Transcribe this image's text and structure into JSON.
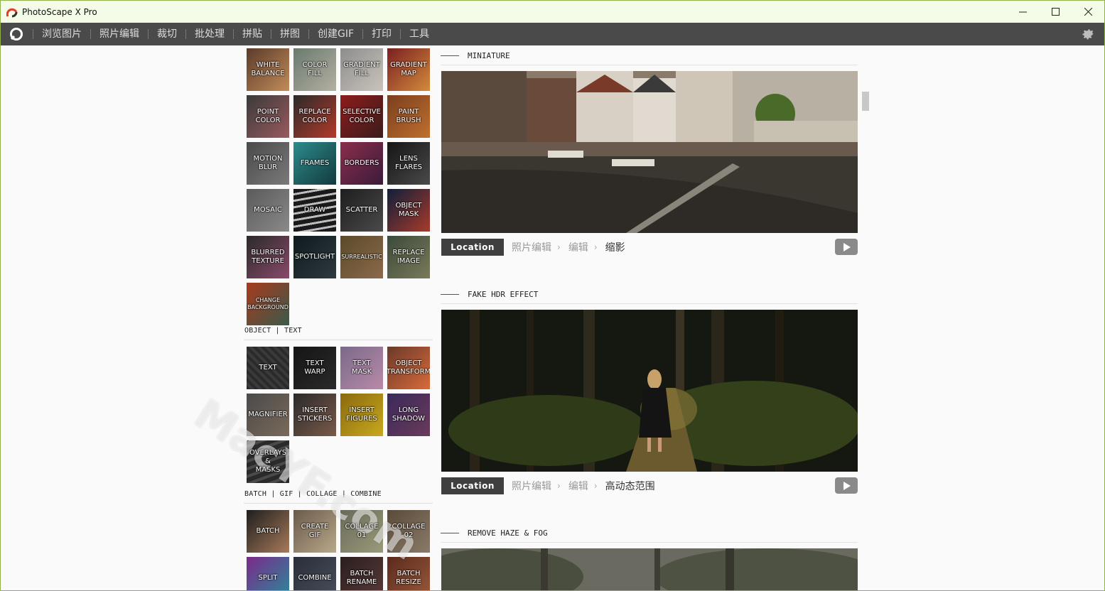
{
  "window": {
    "title": "PhotoScape X Pro"
  },
  "menu": {
    "items": [
      "浏览图片",
      "照片编辑",
      "裁切",
      "批处理",
      "拼贴",
      "拼图",
      "创建GIF",
      "打印",
      "工具"
    ]
  },
  "tiles_top": [
    {
      "label": "WHITE\nBALANCE",
      "bg": "linear-gradient(135deg,#5a3b2a,#c28c5a)"
    },
    {
      "label": "COLOR\nFILL",
      "bg": "linear-gradient(135deg,#6a7a6e,#b3b0a2)"
    },
    {
      "label": "GRADIENT\nFILL",
      "bg": "linear-gradient(135deg,#8d8d8d,#c9c3bb)"
    },
    {
      "label": "GRADIENT\nMAP",
      "bg": "linear-gradient(135deg,#7a1f22,#d38b3b)"
    },
    {
      "label": "POINT\nCOLOR",
      "bg": "linear-gradient(135deg,#3a3a3a,#9a5a5e)"
    },
    {
      "label": "REPLACE\nCOLOR",
      "bg": "linear-gradient(135deg,#2a2a2a,#b43a2a)"
    },
    {
      "label": "SELECTIVE\nCOLOR",
      "bg": "linear-gradient(135deg,#8e1c1c,#3a1c1c)"
    },
    {
      "label": "PAINT\nBRUSH",
      "bg": "linear-gradient(135deg,#7a3e1e,#c0702e)"
    },
    {
      "label": "MOTION\nBLUR",
      "bg": "linear-gradient(135deg,#4a4a4a,#7a7a7a)"
    },
    {
      "label": "FRAMES",
      "bg": "linear-gradient(135deg,#2d8b8b,#123a3e)"
    },
    {
      "label": "BORDERS",
      "bg": "linear-gradient(135deg,#8a2e4a,#3b1b3b)"
    },
    {
      "label": "LENS\nFLARES",
      "bg": "linear-gradient(135deg,#151515,#4a4a4a)"
    },
    {
      "label": "MOSAIC",
      "bg": "linear-gradient(135deg,#5a5a5a,#8a8a8a)"
    },
    {
      "label": "DRAW",
      "bg": "repeating-linear-gradient(170deg,#1a1a1a 0 6px,#bdbdbd 6px 9px)"
    },
    {
      "label": "SCATTER",
      "bg": "linear-gradient(135deg,#1e1e1e,#4a4a4a)"
    },
    {
      "label": "OBJECT\nMASK",
      "bg": "linear-gradient(135deg,#0f1f3a,#a83a2a)"
    },
    {
      "label": "BLURRED\nTEXTURE",
      "bg": "linear-gradient(135deg,#2a2a2a,#8a4a6a)"
    },
    {
      "label": "SPOTLIGHT",
      "bg": "linear-gradient(135deg,#0e1a1e,#2e3a3e)"
    },
    {
      "label": "SURREALISTIC",
      "bg": "linear-gradient(135deg,#5a4a2a,#8b6a4a)",
      "small": true
    },
    {
      "label": "REPLACE\nIMAGE",
      "bg": "linear-gradient(135deg,#3b4a3a,#7a7a5a)"
    },
    {
      "label": "CHANGE\nBACKGROUND",
      "bg": "linear-gradient(135deg,#a83a1e,#3a5a4a)",
      "small": true
    }
  ],
  "section_object": {
    "label": "OBJECT | TEXT"
  },
  "tiles_object": [
    {
      "label": "TEXT",
      "bg": "repeating-linear-gradient(45deg,#2a2a2a 0 4px,#3a3a3a 4px 8px)"
    },
    {
      "label": "TEXT\nWARP",
      "bg": "linear-gradient(135deg,#151515,#2a2a2a)"
    },
    {
      "label": "TEXT\nMASK",
      "bg": "linear-gradient(135deg,#7a6a8a,#b98aa8)"
    },
    {
      "label": "OBJECT\nTRANSFORM",
      "bg": "linear-gradient(135deg,#6a3a2a,#d86a3a)"
    },
    {
      "label": "MAGNIFIER",
      "bg": "linear-gradient(135deg,#4a4a4a,#7a6a5a)"
    },
    {
      "label": "INSERT\nSTICKERS",
      "bg": "linear-gradient(135deg,#2a2a2a,#7a5a4a)"
    },
    {
      "label": "INSERT\nFIGURES",
      "bg": "linear-gradient(135deg,#8a6a0e,#c8a81e)"
    },
    {
      "label": "LONG\nSHADOW",
      "bg": "linear-gradient(135deg,#3a2a5a,#6a3a5a)"
    },
    {
      "label": "OVERLAYS\n&\nMASKS",
      "bg": "repeating-linear-gradient(160deg,#2a2a2a 0 6px,#4a4a4a 6px 10px)"
    }
  ],
  "section_batch": {
    "label": "BATCH | GIF | COLLAGE | COMBINE"
  },
  "tiles_batch": [
    {
      "label": "BATCH",
      "bg": "linear-gradient(135deg,#1e1e1e,#a87a5a)"
    },
    {
      "label": "CREATE\nGIF",
      "bg": "linear-gradient(135deg,#6a5a4a,#b8a88a)"
    },
    {
      "label": "COLLAGE\n01",
      "bg": "linear-gradient(135deg,#6a6a5a,#9a9a7a)"
    },
    {
      "label": "COLLAGE\n02",
      "bg": "linear-gradient(135deg,#5a4a3a,#8a7a6a)"
    },
    {
      "label": "SPLIT",
      "bg": "linear-gradient(135deg,#7a2a8a,#2a8a9a)"
    },
    {
      "label": "COMBINE",
      "bg": "linear-gradient(135deg,#2a2e3a,#4a4e5a)"
    },
    {
      "label": "BATCH\nRENAME",
      "bg": "linear-gradient(135deg,#2a1e1e,#5a3a3a)"
    },
    {
      "label": "BATCH\nRESIZE",
      "bg": "linear-gradient(135deg,#5a2a1e,#9a5a3a)"
    }
  ],
  "feed": [
    {
      "title": "MINIATURE",
      "location": "Location",
      "crumbs": [
        "照片编辑",
        "编辑",
        "缩影"
      ]
    },
    {
      "title": "FAKE HDR EFFECT",
      "location": "Location",
      "crumbs": [
        "照片编辑",
        "编辑",
        "高动态范围"
      ]
    },
    {
      "title": "REMOVE HAZE & FOG"
    }
  ],
  "watermark": "MacYF.com"
}
